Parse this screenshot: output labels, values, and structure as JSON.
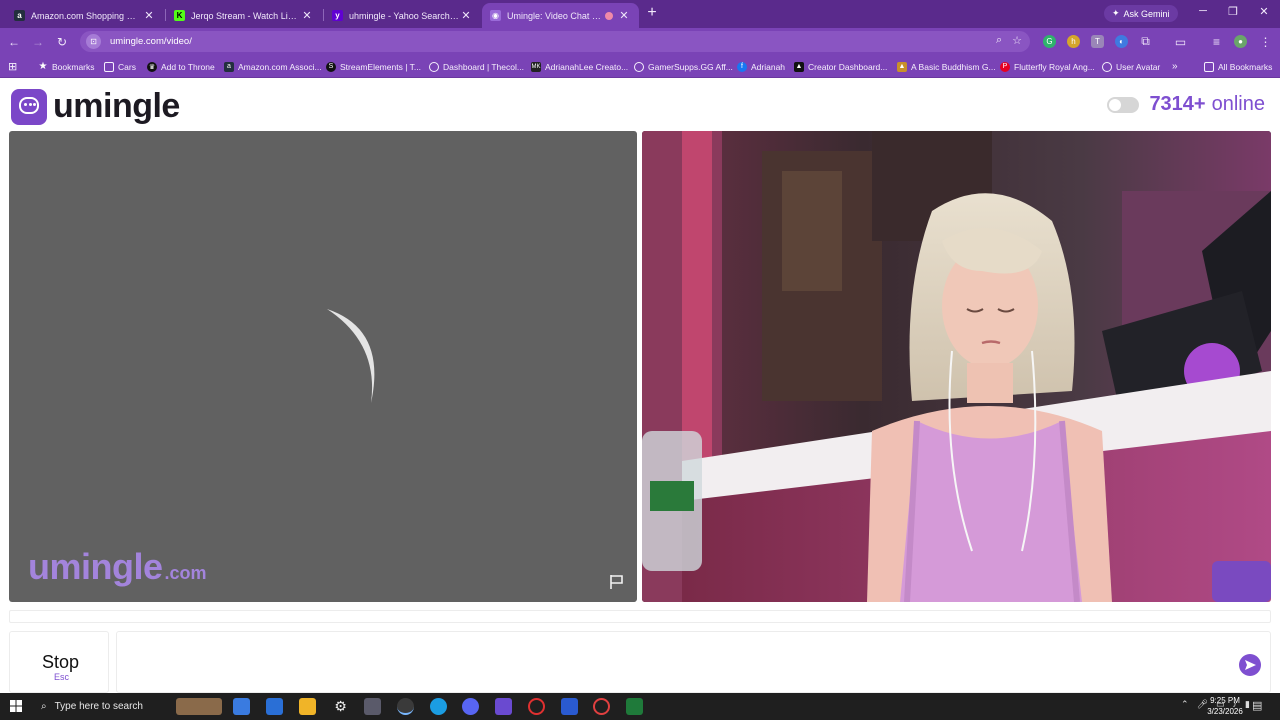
{
  "browser": {
    "tabs": [
      {
        "title": "Amazon.com Shopping Cart",
        "icon": "amazon-icon",
        "active": false
      },
      {
        "title": "Jerqo Stream - Watch Live on K",
        "icon": "kick-icon",
        "active": false
      },
      {
        "title": "uhmingle - Yahoo Search Resul",
        "icon": "yahoo-icon",
        "active": false
      },
      {
        "title": "Umingle: Video Chat with S",
        "icon": "umingle-icon",
        "active": true
      }
    ],
    "ask_gemini": "Ask Gemini",
    "url": "umingle.com/video/",
    "bookmarks": [
      {
        "label": "Bookmarks",
        "icon": "star-icon"
      },
      {
        "label": "Cars",
        "icon": "folder-icon"
      },
      {
        "label": "Add to Throne",
        "icon": "throne-icon"
      },
      {
        "label": "Amazon.com Associ...",
        "icon": "amazon-icon"
      },
      {
        "label": "StreamElements | T...",
        "icon": "streamelements-icon"
      },
      {
        "label": "Dashboard | Thecol...",
        "icon": "globe-icon"
      },
      {
        "label": "AdrianahLee Creato...",
        "icon": "mk-icon"
      },
      {
        "label": "GamerSupps.GG Aff...",
        "icon": "globe-icon"
      },
      {
        "label": "Adrianah",
        "icon": "facebook-icon"
      },
      {
        "label": "Creator Dashboard...",
        "icon": "creator-icon"
      },
      {
        "label": "A Basic Buddhism G...",
        "icon": "buddhism-icon"
      },
      {
        "label": "Flutterfly Royal Ang...",
        "icon": "pinterest-icon"
      },
      {
        "label": "User Avatar",
        "icon": "globe-icon"
      }
    ],
    "all_bookmarks": "All Bookmarks"
  },
  "site": {
    "logo_text": "umingle",
    "online_count": "7314+",
    "online_label": "online",
    "watermark_main": "umingle",
    "watermark_sub": ".com",
    "stop_label": "Stop",
    "stop_hint": "Esc",
    "chat_placeholder": ""
  },
  "taskbar": {
    "search_placeholder": "Type here to search",
    "time": "9:25 PM",
    "date": "3/23/2026"
  },
  "colors": {
    "brand_purple": "#7e4fd0",
    "chrome_dark": "#5a2a8c",
    "chrome_light": "#7a43b6"
  }
}
